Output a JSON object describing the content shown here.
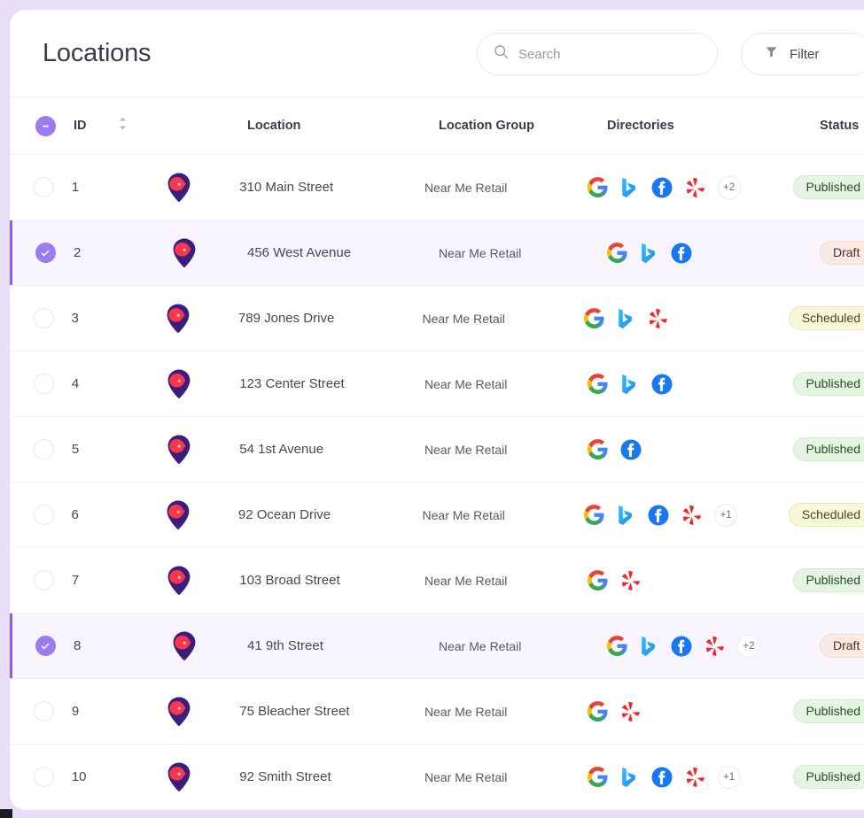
{
  "header": {
    "title": "Locations",
    "search": {
      "placeholder": "Search",
      "value": "",
      "icon": "search-icon"
    },
    "filter": {
      "label": "Filter",
      "icon": "funnel-icon"
    }
  },
  "table": {
    "columns": {
      "select": "",
      "id": "ID",
      "location": "Location",
      "location_group": "Location Group",
      "directories": "Directories",
      "status": "Status"
    },
    "header_checkbox_state": "indeterminate",
    "sort_icon": "sort-chevrons-icon",
    "rows": [
      {
        "id": "1",
        "selected": false,
        "location": "310 Main Street",
        "group": "Near Me Retail",
        "directories": [
          "google",
          "bing",
          "facebook",
          "yelp"
        ],
        "overflow": "+2",
        "status": "Published",
        "status_key": "published"
      },
      {
        "id": "2",
        "selected": true,
        "location": "456 West Avenue",
        "group": "Near Me Retail",
        "directories": [
          "google",
          "bing",
          "facebook"
        ],
        "overflow": "",
        "status": "Draft",
        "status_key": "draft"
      },
      {
        "id": "3",
        "selected": false,
        "location": "789 Jones Drive",
        "group": "Near Me Retail",
        "directories": [
          "google",
          "bing",
          "yelp"
        ],
        "overflow": "",
        "status": "Scheduled",
        "status_key": "scheduled"
      },
      {
        "id": "4",
        "selected": false,
        "location": "123 Center Street",
        "group": "Near Me Retail",
        "directories": [
          "google",
          "bing",
          "facebook"
        ],
        "overflow": "",
        "status": "Published",
        "status_key": "published"
      },
      {
        "id": "5",
        "selected": false,
        "location": "54 1st Avenue",
        "group": "Near Me Retail",
        "directories": [
          "google",
          "facebook"
        ],
        "overflow": "",
        "status": "Published",
        "status_key": "published"
      },
      {
        "id": "6",
        "selected": false,
        "location": "92 Ocean Drive",
        "group": "Near Me Retail",
        "directories": [
          "google",
          "bing",
          "facebook",
          "yelp"
        ],
        "overflow": "+1",
        "status": "Scheduled",
        "status_key": "scheduled"
      },
      {
        "id": "7",
        "selected": false,
        "location": "103 Broad Street",
        "group": "Near Me Retail",
        "directories": [
          "google",
          "yelp"
        ],
        "overflow": "",
        "status": "Published",
        "status_key": "published"
      },
      {
        "id": "8",
        "selected": true,
        "location": "41 9th Street",
        "group": "Near Me Retail",
        "directories": [
          "google",
          "bing",
          "facebook",
          "yelp"
        ],
        "overflow": "+2",
        "status": "Draft",
        "status_key": "draft"
      },
      {
        "id": "9",
        "selected": false,
        "location": "75 Bleacher Street",
        "group": "Near Me Retail",
        "directories": [
          "google",
          "yelp"
        ],
        "overflow": "",
        "status": "Published",
        "status_key": "published"
      },
      {
        "id": "10",
        "selected": false,
        "location": "92 Smith Street",
        "group": "Near Me Retail",
        "directories": [
          "google",
          "bing",
          "facebook",
          "yelp"
        ],
        "overflow": "+1",
        "status": "Published",
        "status_key": "published"
      }
    ]
  },
  "colors": {
    "page_background": "#e7dff7",
    "accent_purple": "#8b5cf6",
    "checkbox_purple": "#9b7bf0",
    "selected_row": "#f8f5fe",
    "pin_body": "#3b1d7e",
    "pin_inner": "#f8374a",
    "published_bg": "#e4f5e2",
    "draft_bg": "#fbeae4",
    "scheduled_bg": "#f8f7d8"
  }
}
